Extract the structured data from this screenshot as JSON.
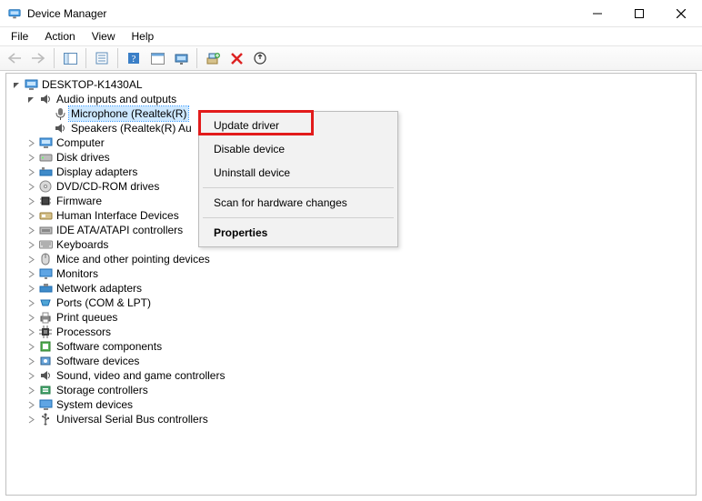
{
  "window": {
    "title": "Device Manager"
  },
  "menubar": {
    "file": "File",
    "action": "Action",
    "view": "View",
    "help": "Help"
  },
  "tree": {
    "root": "DESKTOP-K1430AL",
    "audio": {
      "label": "Audio inputs and outputs",
      "microphone": "Microphone (Realtek(R)",
      "speakers": "Speakers (Realtek(R) Au"
    },
    "computer": "Computer",
    "disk_drives": "Disk drives",
    "display_adapters": "Display adapters",
    "dvd": "DVD/CD-ROM drives",
    "firmware": "Firmware",
    "hid": "Human Interface Devices",
    "ide": "IDE ATA/ATAPI controllers",
    "keyboards": "Keyboards",
    "mice": "Mice and other pointing devices",
    "monitors": "Monitors",
    "network": "Network adapters",
    "ports": "Ports (COM & LPT)",
    "print_queues": "Print queues",
    "processors": "Processors",
    "software_components": "Software components",
    "software_devices": "Software devices",
    "sound": "Sound, video and game controllers",
    "storage": "Storage controllers",
    "system_devices": "System devices",
    "usb": "Universal Serial Bus controllers"
  },
  "context_menu": {
    "update_driver": "Update driver",
    "disable_device": "Disable device",
    "uninstall_device": "Uninstall device",
    "scan": "Scan for hardware changes",
    "properties": "Properties"
  }
}
